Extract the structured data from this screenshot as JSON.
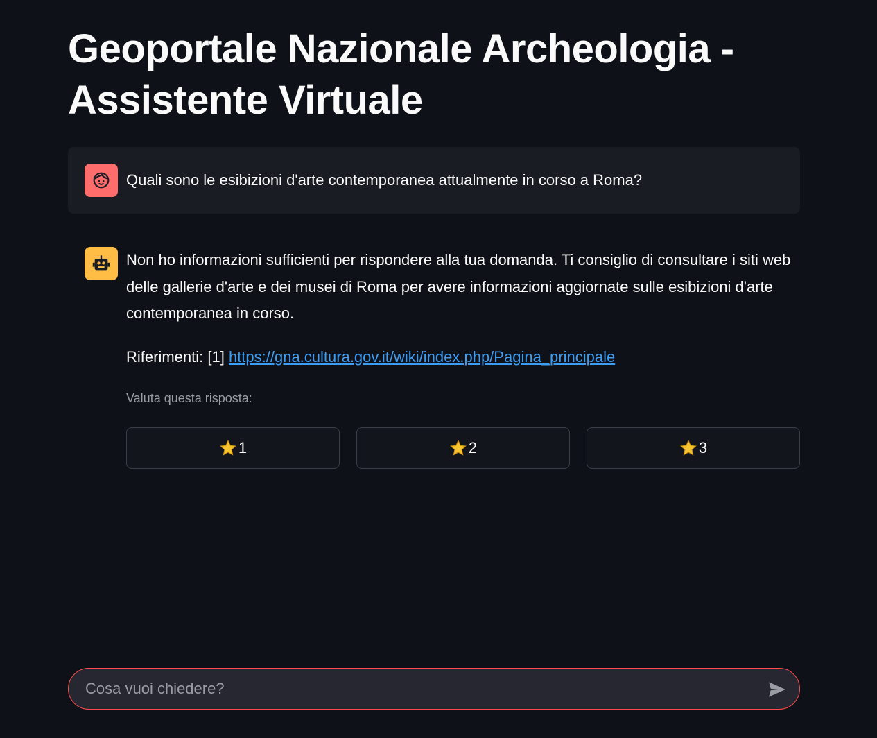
{
  "app": {
    "title": "Geoportale Nazionale Archeologia - Assistente Virtuale"
  },
  "messages": {
    "user": {
      "avatar_icon": "user-face-icon",
      "avatar_color": "#ff6c6c",
      "text": "Quali sono le esibizioni d'arte contemporanea attualmente in corso a Roma?"
    },
    "assistant": {
      "avatar_icon": "robot-icon",
      "avatar_color": "#ffbd45",
      "text": "Non ho informazioni sufficienti per rispondere alla tua domanda. Ti consiglio di consultare i siti web delle gallerie d'arte e dei musei di Roma per avere informazioni aggiornate sulle esibizioni d'arte contemporanea in corso.",
      "references_prefix": "Riferimenti: [1] ",
      "reference_link": "https://gna.cultura.gov.it/wiki/index.php/Pagina_principale"
    }
  },
  "rating": {
    "label": "Valuta questa risposta:",
    "buttons": [
      {
        "icon": "star-icon",
        "label": "1"
      },
      {
        "icon": "star-icon",
        "label": "2"
      },
      {
        "icon": "star-icon",
        "label": "3"
      }
    ]
  },
  "chat_input": {
    "placeholder": "Cosa vuoi chiedere?",
    "value": "",
    "send_icon": "send-icon"
  },
  "colors": {
    "background": "#0e1117",
    "accent": "#ff4b4b",
    "link": "#3d9df3"
  }
}
